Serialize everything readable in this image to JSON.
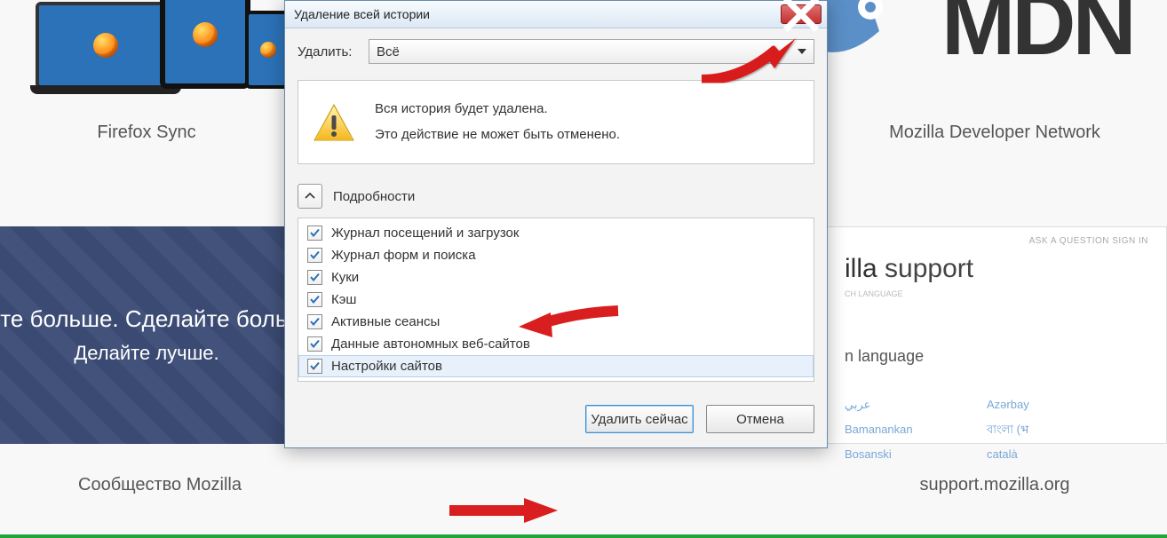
{
  "background": {
    "tile_left_label": "Firefox Sync",
    "tile_right_label": "Mozilla Developer Network",
    "hero_line1": "йте больше. Сделайте больш",
    "hero_line2": "Делайте лучше.",
    "community_label": "Сообщество Mozilla",
    "support_label": "support.mozilla.org",
    "mdn_text": "MDN",
    "support_panel": {
      "meta": "ASK A QUESTION   SIGN IN",
      "title_suffix": "illa",
      "title_light": " support",
      "subhead": "CH LANGUAGE",
      "lang_label": "n language",
      "links": [
        "عربي",
        "Azərbay",
        "Bamanankan",
        "বাংলা (भ",
        "Bosanski",
        "català"
      ]
    }
  },
  "dialog": {
    "title": "Удаление всей истории",
    "delete_label": "Удалить:",
    "delete_value": "Всё",
    "warning_line1": "Вся история будет удалена.",
    "warning_line2": "Это действие не может быть отменено.",
    "details_label": "Подробности",
    "checks": [
      {
        "label": "Журнал посещений и загрузок",
        "checked": true
      },
      {
        "label": "Журнал форм и поиска",
        "checked": true
      },
      {
        "label": "Куки",
        "checked": true
      },
      {
        "label": "Кэш",
        "checked": true
      },
      {
        "label": "Активные сеансы",
        "checked": true
      },
      {
        "label": "Данные автономных веб-сайтов",
        "checked": true
      },
      {
        "label": "Настройки сайтов",
        "checked": true,
        "selected": true
      }
    ],
    "btn_primary": "Удалить сейчас",
    "btn_cancel": "Отмена"
  }
}
